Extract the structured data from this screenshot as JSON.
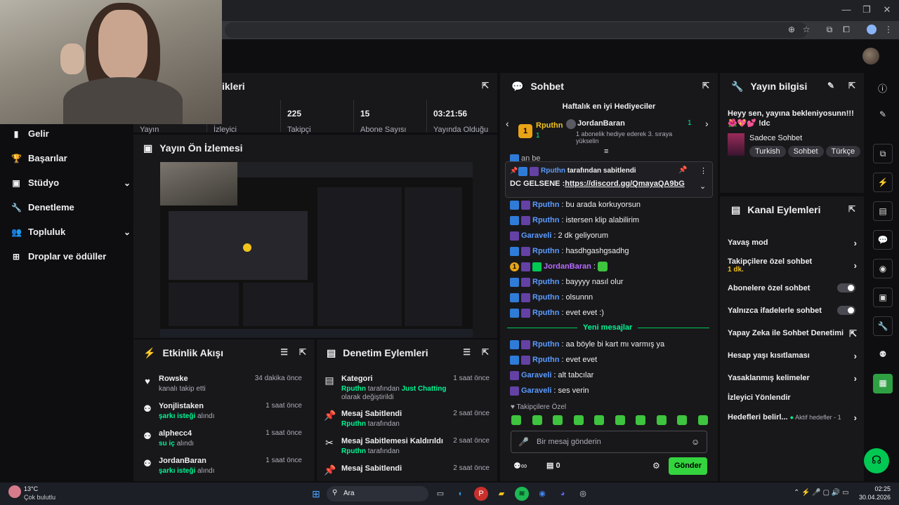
{
  "browser": {
    "window_controls": [
      "—",
      "❐",
      "✕"
    ],
    "toolbar_icons": [
      "⊕",
      "☆",
      "⧉",
      "⧠"
    ]
  },
  "sidebar": {
    "items": [
      {
        "label": "Gelir",
        "icon": "▮"
      },
      {
        "label": "Başarılar",
        "icon": "🏆"
      },
      {
        "label": "Stüdyo",
        "icon": "▣",
        "chevron": "⌄"
      },
      {
        "label": "Denetleme",
        "icon": "🔧"
      },
      {
        "label": "Topluluk",
        "icon": "👥",
        "chevron": "⌄"
      },
      {
        "label": "Droplar ve ödüller",
        "icon": "⊞"
      }
    ]
  },
  "stats": {
    "title": "ikleri",
    "items": [
      {
        "value": "",
        "label": "Yayın"
      },
      {
        "value": "",
        "label": "İzleyici"
      },
      {
        "value": "225",
        "label": "Takipçi"
      },
      {
        "value": "15",
        "label": "Abone Sayısı"
      },
      {
        "value": "03:21:56",
        "label": "Yayında Olduğu"
      }
    ]
  },
  "preview": {
    "title": "Yayın Ön İzlemesi"
  },
  "activity": {
    "title": "Etkinlik Akışı",
    "items": [
      {
        "icon": "♥",
        "name": "Rowske",
        "time": "34 dakika önce",
        "desc": "kanalı takip etti",
        "highlight": ""
      },
      {
        "icon": "⚉",
        "name": "Yonjlistaken",
        "time": "1 saat önce",
        "desc": "alındı",
        "highlight": "şarkı isteği"
      },
      {
        "icon": "⚉",
        "name": "alphecc4",
        "time": "1 saat önce",
        "desc": "alındı",
        "highlight": "su iç"
      },
      {
        "icon": "⚉",
        "name": "JordanBaran",
        "time": "1 saat önce",
        "desc": "alındı",
        "highlight": "şarkı isteği"
      }
    ]
  },
  "modlog": {
    "title": "Denetim Eylemleri",
    "items": [
      {
        "icon": "▤",
        "name": "Kategori",
        "time": "1 saat önce",
        "user": "Rputhn",
        "middle": "tarafından",
        "target": "Just Chatting",
        "rest": "olarak değiştirildi"
      },
      {
        "icon": "📌",
        "name": "Mesaj Sabitlendi",
        "time": "2 saat önce",
        "user": "Rputhn",
        "middle": "tarafından",
        "target": "",
        "rest": ""
      },
      {
        "icon": "✂",
        "name": "Mesaj Sabitlemesi Kaldırıldı",
        "time": "2 saat önce",
        "user": "Rputhn",
        "middle": "tarafından",
        "target": "",
        "rest": ""
      },
      {
        "icon": "📌",
        "name": "Mesaj Sabitlendi",
        "time": "2 saat önce",
        "user": "",
        "middle": "",
        "target": "",
        "rest": ""
      }
    ]
  },
  "chat": {
    "title": "Sohbet",
    "leaderboard_title": "Haftalık en iyi Hediyeciler",
    "leader1": {
      "name": "Rputhn",
      "rank": "1",
      "count": "1"
    },
    "leader2": {
      "name": "JordanBaran",
      "count": "1",
      "desc": "1 abonelik hediye ederek 3. sıraya yükselin"
    },
    "pinned": {
      "by": "Rputhn",
      "label": "tarafından sabitlendi",
      "text": "DC GELSENE :",
      "link": "https://discord.gg/QmayaQA9bG"
    },
    "partial_msg": "an be",
    "messages": [
      {
        "user": "Rputhn",
        "color": "#5b9bff",
        "text": "bu arada korkuyorsun",
        "badges": [
          "blue",
          "purple"
        ]
      },
      {
        "user": "Rputhn",
        "color": "#5b9bff",
        "text": "istersen klip alabilirim",
        "badges": [
          "blue",
          "purple"
        ]
      },
      {
        "user": "Garaveli",
        "color": "#5b9bff",
        "text": "2 dk geliyorum",
        "badges": [
          "purple"
        ]
      },
      {
        "user": "Rputhn",
        "color": "#5b9bff",
        "text": "hasdhgashgsadhg",
        "badges": [
          "blue",
          "purple"
        ]
      },
      {
        "user": "JordanBaran",
        "color": "#b86bff",
        "text": "",
        "badges": [
          "gold",
          "purple",
          "green"
        ]
      },
      {
        "user": "Rputhn",
        "color": "#5b9bff",
        "text": "bayyyy nasıl olur",
        "badges": [
          "blue",
          "purple"
        ]
      },
      {
        "user": "Rputhn",
        "color": "#5b9bff",
        "text": "olsunnn",
        "badges": [
          "blue",
          "purple"
        ]
      },
      {
        "user": "Rputhn",
        "color": "#5b9bff",
        "text": "evet evet :)",
        "badges": [
          "blue",
          "purple"
        ]
      }
    ],
    "new_messages_label": "Yeni mesajlar",
    "new_messages": [
      {
        "user": "Rputhn",
        "color": "#5b9bff",
        "text": "aa böyle bi kart mı varmış ya",
        "badges": [
          "blue",
          "purple"
        ]
      },
      {
        "user": "Rputhn",
        "color": "#5b9bff",
        "text": "evet evet",
        "badges": [
          "blue",
          "purple"
        ]
      },
      {
        "user": "Garaveli",
        "color": "#5b9bff",
        "text": "alt tabcılar",
        "badges": [
          "purple"
        ]
      },
      {
        "user": "Garaveli",
        "color": "#5b9bff",
        "text": "ses verin",
        "badges": [
          "purple"
        ]
      }
    ],
    "followers_only": "Takipçilere Özel",
    "input_placeholder": "Bir mesaj gönderin",
    "points": "0",
    "send_label": "Gönder"
  },
  "stream_info": {
    "title": "Yayın bilgisi",
    "stream_title": "Heyy sen, yayına bekleniyosunn!!! 🌺💖💕 !dc",
    "category": "Sadece Sohbet",
    "tags": [
      "Turkish",
      "Sohbet",
      "Türkçe"
    ]
  },
  "channel_actions": {
    "title": "Kanal Eylemleri",
    "slow_mode": "Yavaş mod",
    "followers_chat": "Takipçilere özel sohbet",
    "followers_chat_value": "1 dk.",
    "subs_chat": "Abonelere özel sohbet",
    "emote_chat": "Yalnızca ifadelerle sohbet",
    "ai_mod": "Yapay Zeka ile Sohbet Denetimi",
    "age_restrict": "Hesap yaşı kısıtlaması",
    "banned_words": "Yasaklanmış kelimeler",
    "viewer_redirect": "İzleyici Yönlendir",
    "goals": "Hedefleri belirl...",
    "goals_status": "Aktif hedefler - 1"
  },
  "taskbar": {
    "weather_temp": "13°C",
    "weather_desc": "Çok bulutlu",
    "search_label": "Ara",
    "time": "02:25",
    "date": "30.04.2026"
  },
  "colors": {
    "accent": "#00f593",
    "twitch_purple": "#9147ff",
    "send_button": "#34d43f",
    "panel": "#18181b",
    "bg": "#0e0e10"
  }
}
